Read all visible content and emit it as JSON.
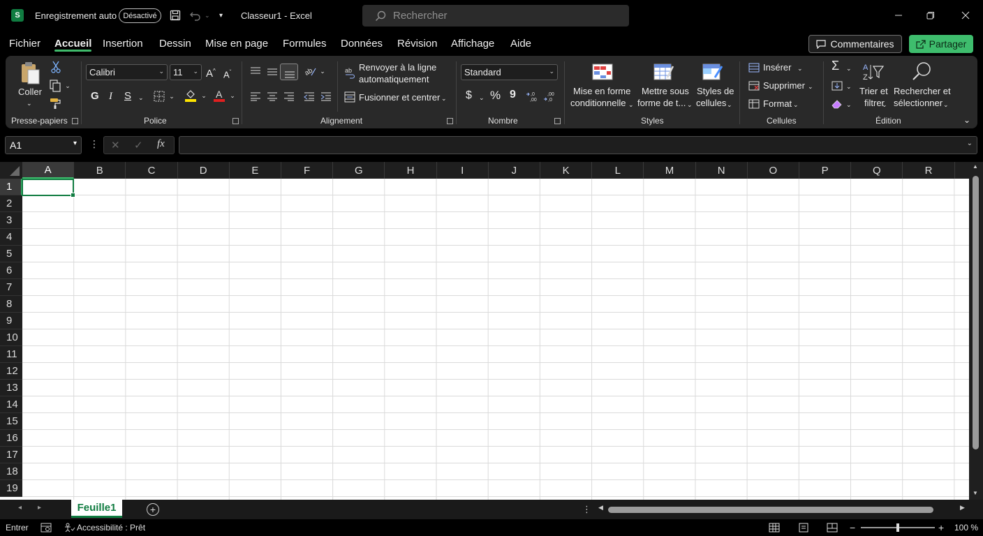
{
  "titlebar": {
    "app_icon": "S",
    "autosave_label": "Enregistrement auto",
    "autosave_state": "Désactivé",
    "document_title": "Classeur1 - Excel",
    "search_placeholder": "Rechercher",
    "icons": [
      "excel-app-icon",
      "save-icon",
      "undo-icon",
      "customize-quick-access-icon",
      "search-icon",
      "minimize-icon",
      "restore-icon",
      "close-icon"
    ]
  },
  "menu": {
    "tabs": [
      "Fichier",
      "Accueil",
      "Insertion",
      "Dessin",
      "Mise en page",
      "Formules",
      "Données",
      "Révision",
      "Affichage",
      "Aide"
    ],
    "active_tab": "Accueil",
    "comments_label": "Commentaires",
    "share_label": "Partager"
  },
  "ribbon": {
    "clipboard": {
      "paste_label": "Coller",
      "group_label": "Presse-papiers"
    },
    "font": {
      "font_name": "Calibri",
      "font_size": "11",
      "bold": "G",
      "italic": "I",
      "underline": "S",
      "group_label": "Police"
    },
    "alignment": {
      "wrap_text_line1": "Renvoyer à la ligne",
      "wrap_text_line2": "automatiquement",
      "merge_label": "Fusionner et centrer",
      "group_label": "Alignement"
    },
    "number": {
      "format": "Standard",
      "currency": "$",
      "percent": "%",
      "comma": "9",
      "group_label": "Nombre"
    },
    "styles": {
      "conditional_line1": "Mise en forme",
      "conditional_line2": "conditionnelle",
      "table_line1": "Mettre sous",
      "table_line2": "forme de t...",
      "cell_styles_line1": "Styles de",
      "cell_styles_line2": "cellules",
      "group_label": "Styles"
    },
    "cells": {
      "insert_label": "Insérer",
      "delete_label": "Supprimer",
      "format_label": "Format",
      "group_label": "Cellules"
    },
    "editing": {
      "sort_line1": "Trier et",
      "sort_line2": "filtrer",
      "find_line1": "Rechercher et",
      "find_line2": "sélectionner",
      "group_label": "Édition"
    }
  },
  "formula_bar": {
    "name_box": "A1",
    "formula_value": ""
  },
  "grid": {
    "columns": [
      "A",
      "B",
      "C",
      "D",
      "E",
      "F",
      "G",
      "H",
      "I",
      "J",
      "K",
      "L",
      "M",
      "N",
      "O",
      "P",
      "Q",
      "R"
    ],
    "rows": [
      "1",
      "2",
      "3",
      "4",
      "5",
      "6",
      "7",
      "8",
      "9",
      "10",
      "11",
      "12",
      "13",
      "14",
      "15",
      "16",
      "17",
      "18",
      "19"
    ],
    "active_cell": "A1"
  },
  "sheets": {
    "tabs": [
      "Feuille1"
    ],
    "active": "Feuille1"
  },
  "status": {
    "mode": "Entrer",
    "accessibility": "Accessibilité : Prêt",
    "zoom": "100 %"
  },
  "colors": {
    "accent": "#107c41",
    "share": "#3ebd6d",
    "ribbon": "#292929"
  }
}
